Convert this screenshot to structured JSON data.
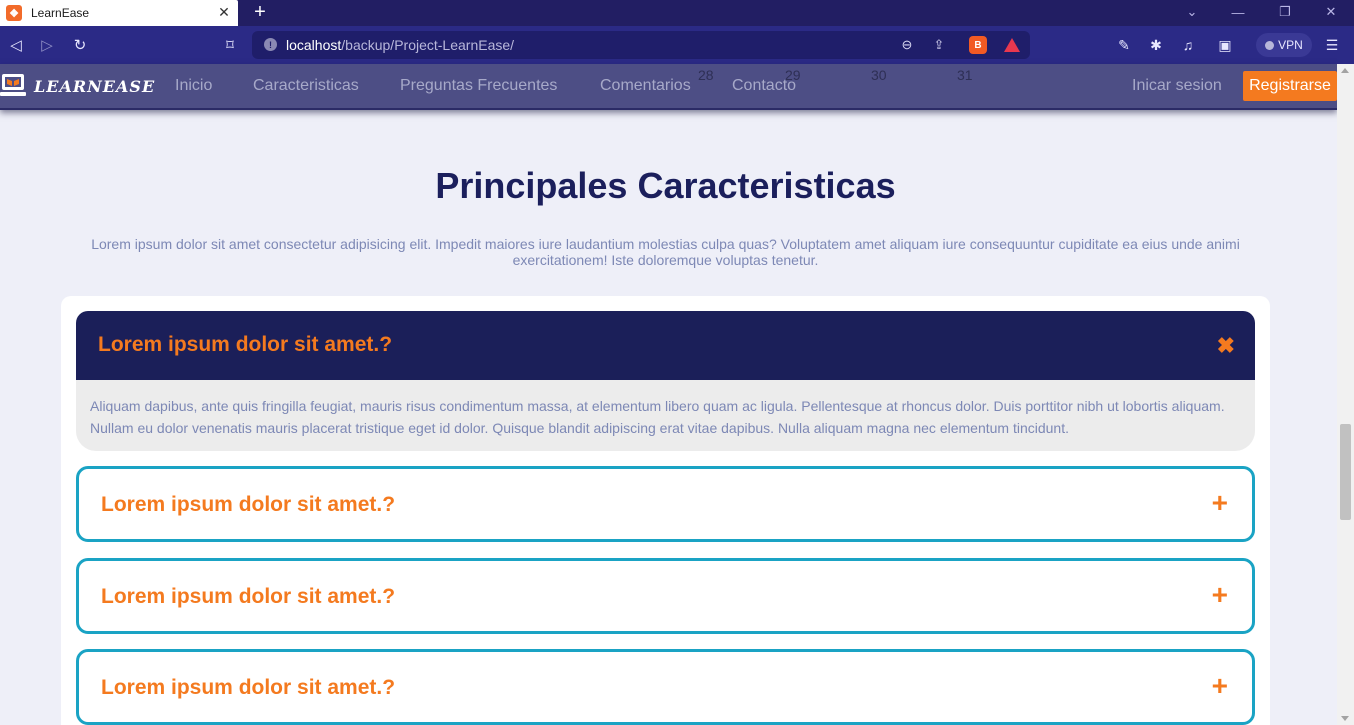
{
  "browser": {
    "tab_title": "LearnEase",
    "tab_favicon_glyph": "❖",
    "url_host": "localhost",
    "url_path": "/backup/Project-LearnEase/",
    "vpn_label": "VPN"
  },
  "site_nav": {
    "logo_text": "LEARNEASE",
    "links": [
      "Inicio",
      "Caracteristicas",
      "Preguntas Frecuentes",
      "Comentarios",
      "Contacto"
    ],
    "calendar_numbers": [
      "28",
      "29",
      "30",
      "31"
    ],
    "login_label": "Inicar sesion",
    "register_label": "Registrarse"
  },
  "features": {
    "title": "Principales Caracteristicas",
    "description": "Lorem ipsum dolor sit amet consectetur adipisicing elit. Impedit maiores iure laudantium molestias culpa quas? Voluptatem amet aliquam iure consequuntur cupiditate ea eius unde animi exercitationem! Iste doloremque voluptas tenetur."
  },
  "faq": {
    "open_item": {
      "question": "Lorem ipsum dolor sit amet.?",
      "answer": "Aliquam dapibus, ante quis fringilla feugiat, mauris risus condimentum massa, at elementum libero quam ac ligula. Pellentesque at rhoncus dolor. Duis porttitor nibh ut lobortis aliquam. Nullam eu dolor venenatis mauris placerat tristique eget id dolor. Quisque blandit adipiscing erat vitae dapibus. Nulla aliquam magna nec elementum tincidunt.",
      "close_glyph": "✖"
    },
    "items": [
      {
        "question": "Lorem ipsum dolor sit amet.?",
        "toggle_glyph": "+"
      },
      {
        "question": "Lorem ipsum dolor sit amet.?",
        "toggle_glyph": "+"
      },
      {
        "question": "Lorem ipsum dolor sit amet.?",
        "toggle_glyph": "+"
      }
    ]
  },
  "colors": {
    "accent": "#f47a1f",
    "navy": "#1b1f59",
    "item_border": "#1aa3c4"
  }
}
